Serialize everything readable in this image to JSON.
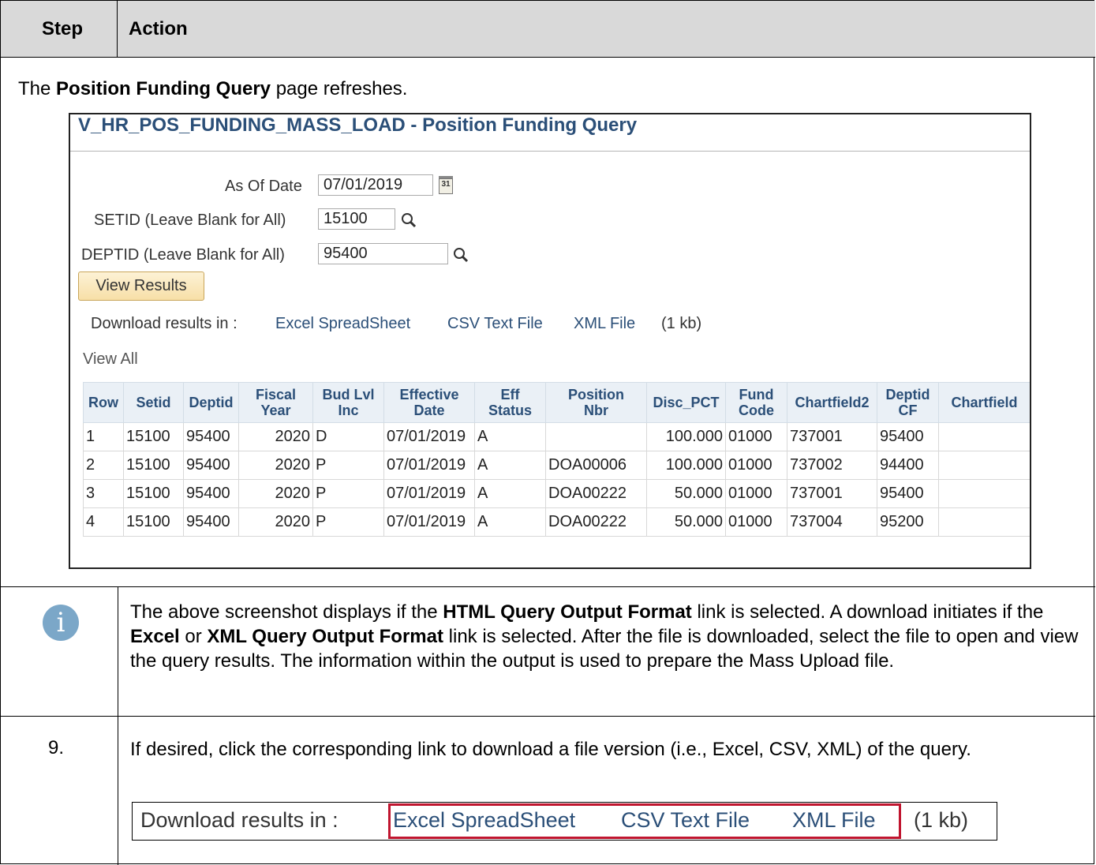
{
  "header": {
    "step": "Step",
    "action": "Action"
  },
  "intro": {
    "prefix": "The ",
    "bold": "Position Funding Query",
    "suffix": " page refreshes."
  },
  "screenshot": {
    "title": "V_HR_POS_FUNDING_MASS_LOAD - Position Funding Query",
    "as_of_date": {
      "label": "As Of Date",
      "value": "07/01/2019"
    },
    "setid": {
      "label": "SETID (Leave Blank for All)",
      "value": "15100"
    },
    "deptid": {
      "label": "DEPTID (Leave Blank for All)",
      "value": "95400"
    },
    "view_results": "View Results",
    "download": {
      "label": "Download results in :",
      "excel": "Excel SpreadSheet",
      "csv": "CSV Text File",
      "xml": "XML File",
      "size": "(1 kb)"
    },
    "view_all": "View All",
    "columns": [
      {
        "l1": "Row",
        "l2": ""
      },
      {
        "l1": "Setid",
        "l2": ""
      },
      {
        "l1": "Deptid",
        "l2": ""
      },
      {
        "l1": "Fiscal",
        "l2": "Year"
      },
      {
        "l1": "Bud Lvl",
        "l2": "Inc"
      },
      {
        "l1": "Effective",
        "l2": "Date"
      },
      {
        "l1": "Eff",
        "l2": "Status"
      },
      {
        "l1": "Position",
        "l2": "Nbr"
      },
      {
        "l1": "Disc_PCT",
        "l2": ""
      },
      {
        "l1": "Fund",
        "l2": "Code"
      },
      {
        "l1": "Chartfield2",
        "l2": ""
      },
      {
        "l1": "Deptid",
        "l2": "CF"
      },
      {
        "l1": "Chartfield",
        "l2": ""
      }
    ],
    "rows": [
      [
        "1",
        "15100",
        "95400",
        "2020",
        "D",
        "07/01/2019",
        "A",
        "",
        "100.000",
        "01000",
        "737001",
        "95400",
        ""
      ],
      [
        "2",
        "15100",
        "95400",
        "2020",
        "P",
        "07/01/2019",
        "A",
        "DOA00006",
        "100.000",
        "01000",
        "737002",
        "94400",
        ""
      ],
      [
        "3",
        "15100",
        "95400",
        "2020",
        "P",
        "07/01/2019",
        "A",
        "DOA00222",
        "50.000",
        "01000",
        "737001",
        "95400",
        ""
      ],
      [
        "4",
        "15100",
        "95400",
        "2020",
        "P",
        "07/01/2019",
        "A",
        "DOA00222",
        "50.000",
        "01000",
        "737004",
        "95200",
        ""
      ]
    ]
  },
  "info": {
    "icon": "info-icon",
    "t1": "The above screenshot displays if the ",
    "b1": "HTML Query Output Format",
    "t2": " link is selected.  A download initiates if the ",
    "b2": "Excel",
    "t3": " or ",
    "b3": "XML Query Output Format",
    "t4": " link is selected.  After the file is downloaded, select the file to open and view the query results.  The information within the output is used to prepare the Mass Upload file."
  },
  "step9": {
    "number": "9.",
    "text": "If desired, click the corresponding link to download a file version (i.e., Excel, CSV, XML) of the query.",
    "download_label": "Download results in :",
    "excel": "Excel SpreadSheet",
    "csv": "CSV Text File",
    "xml": "XML File",
    "size": "(1 kb)",
    "highlight_color": "#c0152f"
  }
}
